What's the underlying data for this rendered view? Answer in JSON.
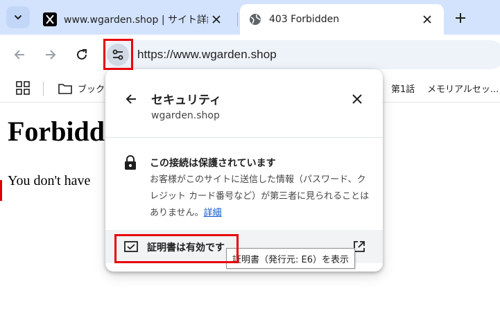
{
  "tabs": [
    {
      "title": "www.wgarden.shop | サイト詳細",
      "favicon": "x-logo-icon",
      "active": false
    },
    {
      "title": "403 Forbidden",
      "favicon": "globe-icon",
      "active": true
    }
  ],
  "toolbar": {
    "url": "https://www.wgarden.shop"
  },
  "bookmarks": {
    "items": [
      {
        "label": "ブックマ"
      },
      {
        "label": "第1話"
      },
      {
        "label": "メモリアルセッ..."
      }
    ]
  },
  "page": {
    "heading": "Forbidden",
    "message": "You don't have"
  },
  "popup": {
    "title": "セキュリティ",
    "subtitle": "wgarden.shop",
    "connection_title": "この接続は保護されています",
    "connection_desc": "お客様がこのサイトに送信した情報（パスワード、クレジット カード番号など）が第三者に見られることはありません。",
    "details_link": "詳細",
    "certificate_label": "証明書は有効です"
  },
  "tooltip": "証明書（発行元: E6）を表示",
  "colors": {
    "highlight": "#e8000b",
    "tabstrip": "#d3e3fd",
    "link": "#0b57d0"
  }
}
